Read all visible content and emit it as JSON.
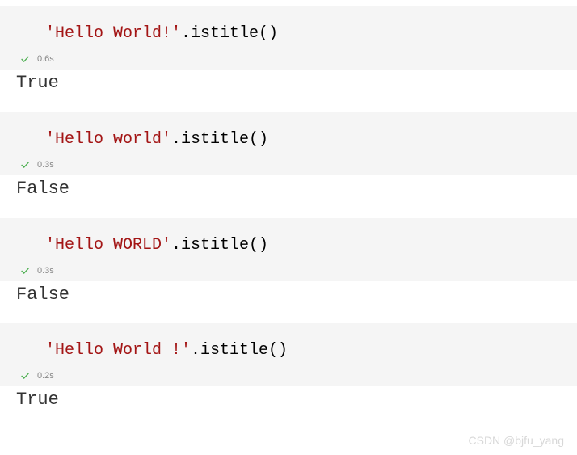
{
  "cells": [
    {
      "code_str": "'Hello World!'",
      "code_method": ".istitle()",
      "timing": "0.6s",
      "output": "True"
    },
    {
      "code_str": "'Hello world'",
      "code_method": ".istitle()",
      "timing": "0.3s",
      "output": "False"
    },
    {
      "code_str": "'Hello WORLD'",
      "code_method": ".istitle()",
      "timing": "0.3s",
      "output": "False"
    },
    {
      "code_str": "'Hello World !'",
      "code_method": ".istitle()",
      "timing": "0.2s",
      "output": "True"
    }
  ],
  "watermark": "CSDN @bjfu_yang"
}
